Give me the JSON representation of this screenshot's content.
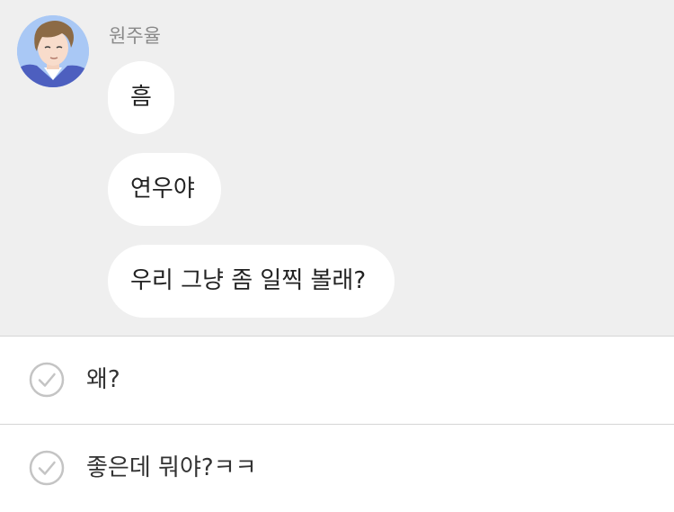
{
  "chat": {
    "sender_name": "원주율",
    "avatar_icon": "person-portrait-icon",
    "messages": [
      {
        "text": "흠"
      },
      {
        "text": "연우야"
      },
      {
        "text": "우리 그냥 좀 일찍 볼래?"
      }
    ]
  },
  "replies": [
    {
      "text": "왜?",
      "icon": "check-circle-icon"
    },
    {
      "text": "좋은데 뭐야?ㅋㅋ",
      "icon": "check-circle-icon"
    }
  ],
  "colors": {
    "chat_background": "#efefef",
    "bubble": "#ffffff",
    "divider": "#d6d6d6",
    "check_icon": "#c4c4c4",
    "sender_name": "#8a8a8a"
  }
}
